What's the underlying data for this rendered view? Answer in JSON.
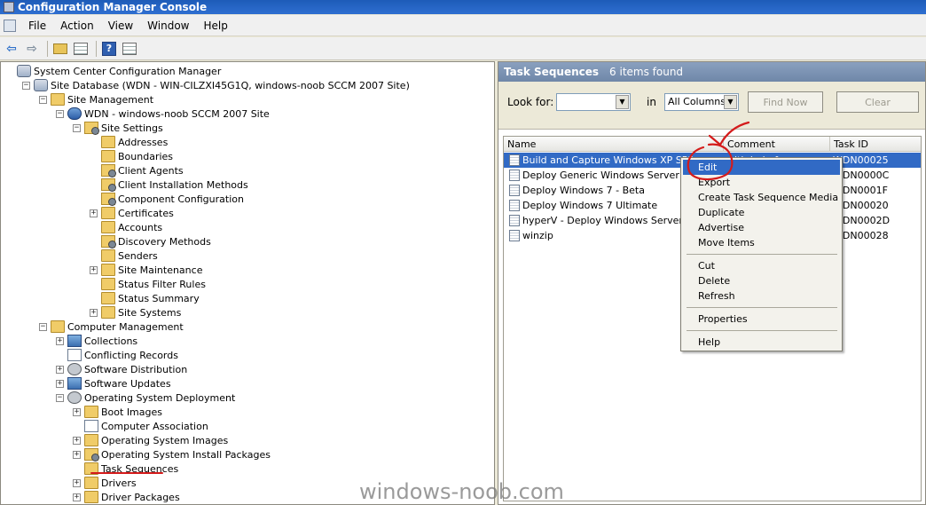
{
  "window": {
    "title": "Configuration Manager Console"
  },
  "menu": [
    "File",
    "Action",
    "View",
    "Window",
    "Help"
  ],
  "toolbar": {
    "icons": [
      "back-arrow-icon",
      "forward-arrow-icon",
      "up-folder-icon",
      "show-hide-tree-icon",
      "help-icon",
      "console-icon"
    ],
    "back": "⇦",
    "forward": "⇨",
    "help": "?"
  },
  "tree": {
    "expand_symbol": "+",
    "collapse_symbol": "−",
    "nodes": [
      {
        "label": "System Center Configuration Manager",
        "level": 0,
        "expander": "none",
        "icon": "console"
      },
      {
        "label": "Site Database  (WDN - WIN-CILZXI45G1Q, windows-noob SCCM 2007 Site)",
        "level": 1,
        "expander": "minus",
        "icon": "db"
      },
      {
        "label": "Site Management",
        "level": 2,
        "expander": "minus",
        "icon": "folder"
      },
      {
        "label": "WDN - windows-noob SCCM 2007 Site",
        "level": 3,
        "expander": "minus",
        "icon": "server"
      },
      {
        "label": "Site Settings",
        "level": 4,
        "expander": "minus",
        "icon": "folder-gear"
      },
      {
        "label": "Addresses",
        "level": 5,
        "expander": "none",
        "icon": "folder"
      },
      {
        "label": "Boundaries",
        "level": 5,
        "expander": "none",
        "icon": "folder"
      },
      {
        "label": "Client Agents",
        "level": 5,
        "expander": "none",
        "icon": "folder-gear"
      },
      {
        "label": "Client Installation Methods",
        "level": 5,
        "expander": "none",
        "icon": "folder-gear"
      },
      {
        "label": "Component Configuration",
        "level": 5,
        "expander": "none",
        "icon": "folder-gear"
      },
      {
        "label": "Certificates",
        "level": 5,
        "expander": "plus",
        "icon": "folder"
      },
      {
        "label": "Accounts",
        "level": 5,
        "expander": "none",
        "icon": "folder"
      },
      {
        "label": "Discovery Methods",
        "level": 5,
        "expander": "none",
        "icon": "folder-gear"
      },
      {
        "label": "Senders",
        "level": 5,
        "expander": "none",
        "icon": "folder"
      },
      {
        "label": "Site Maintenance",
        "level": 5,
        "expander": "plus",
        "icon": "folder"
      },
      {
        "label": "Status Filter Rules",
        "level": 5,
        "expander": "none",
        "icon": "folder"
      },
      {
        "label": "Status Summary",
        "level": 5,
        "expander": "none",
        "icon": "folder"
      },
      {
        "label": "Site Systems",
        "level": 5,
        "expander": "plus",
        "icon": "folder"
      },
      {
        "label": "Computer Management",
        "level": 2,
        "expander": "minus",
        "icon": "folder"
      },
      {
        "label": "Collections",
        "level": 3,
        "expander": "plus",
        "icon": "stack"
      },
      {
        "label": "Conflicting Records",
        "level": 3,
        "expander": "none",
        "icon": "page"
      },
      {
        "label": "Software Distribution",
        "level": 3,
        "expander": "plus",
        "icon": "gear"
      },
      {
        "label": "Software Updates",
        "level": 3,
        "expander": "plus",
        "icon": "stack"
      },
      {
        "label": "Operating System Deployment",
        "level": 3,
        "expander": "minus",
        "icon": "gear"
      },
      {
        "label": "Boot Images",
        "level": 4,
        "expander": "plus",
        "icon": "folder"
      },
      {
        "label": "Computer Association",
        "level": 4,
        "expander": "none",
        "icon": "page"
      },
      {
        "label": "Operating System Images",
        "level": 4,
        "expander": "plus",
        "icon": "folder"
      },
      {
        "label": "Operating System Install Packages",
        "level": 4,
        "expander": "plus",
        "icon": "folder-gear"
      },
      {
        "label": "Task Sequences",
        "level": 4,
        "expander": "none",
        "icon": "folder",
        "selected": true
      },
      {
        "label": "Drivers",
        "level": 4,
        "expander": "plus",
        "icon": "folder"
      },
      {
        "label": "Driver Packages",
        "level": 4,
        "expander": "plus",
        "icon": "folder"
      }
    ]
  },
  "results": {
    "title": "Task Sequences",
    "count_text": "6 items found",
    "look_for_label": "Look for:",
    "look_for_value": "",
    "in_label": "in",
    "in_value": "All Columns",
    "find_now": "Find Now",
    "clear": "Clear",
    "columns": [
      "Name",
      "Comment",
      "Task ID"
    ],
    "rows": [
      {
        "name": "Build and Capture Windows XP SP3",
        "comment": "with help from www",
        "id": "WDN00025",
        "selected": true
      },
      {
        "name": "Deploy Generic Windows Server 2008",
        "comment": "",
        "id": "WDN0000C"
      },
      {
        "name": "Deploy Windows 7 - Beta",
        "comment": "",
        "id": "WDN0001F"
      },
      {
        "name": "Deploy Windows 7 Ultimate",
        "comment": "",
        "id": "WDN00020"
      },
      {
        "name": "hyperV - Deploy Windows Server 2008",
        "comment": "",
        "id": "WDN0002D"
      },
      {
        "name": "winzip",
        "comment": "",
        "id": "WDN00028"
      }
    ]
  },
  "context_menu": {
    "groups": [
      [
        "Edit",
        "Export",
        "Create Task Sequence Media",
        "Duplicate",
        "Advertise",
        "Move Items"
      ],
      [
        "Cut",
        "Delete",
        "Refresh"
      ],
      [
        "Properties"
      ],
      [
        "Help"
      ]
    ],
    "highlighted": "Edit"
  },
  "annotation_color": "#d41b1b",
  "watermark": "windows-noob.com"
}
